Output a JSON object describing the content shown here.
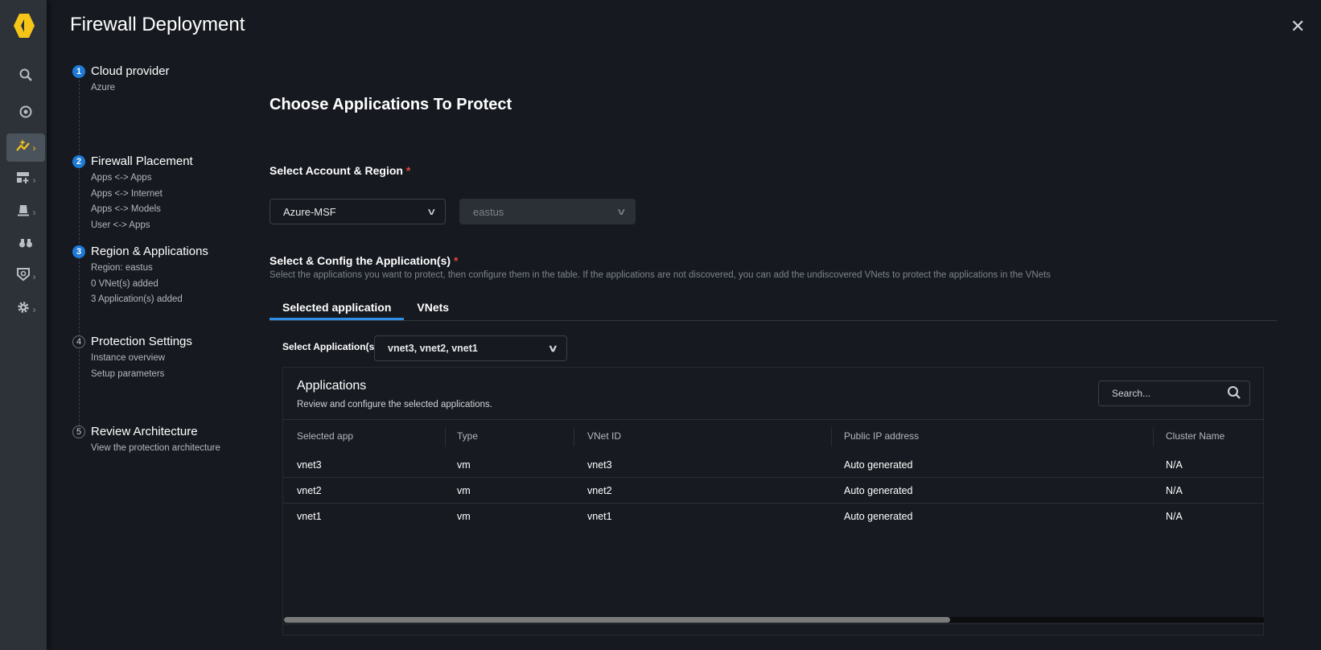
{
  "app": {
    "title": "Firewall Deployment",
    "close": "✕"
  },
  "sidebar": {
    "items": [
      {
        "icon": "search-icon"
      },
      {
        "icon": "radar-icon"
      },
      {
        "icon": "deploy-icon",
        "active": true
      },
      {
        "icon": "dashboard-add-icon"
      },
      {
        "icon": "alarm-icon"
      },
      {
        "icon": "binoculars-icon"
      },
      {
        "icon": "shield-search-icon"
      },
      {
        "icon": "gear-icon"
      }
    ],
    "chevron": "›"
  },
  "steps": [
    {
      "num": "1",
      "title": "Cloud provider",
      "subs": [
        "Azure"
      ]
    },
    {
      "num": "2",
      "title": "Firewall Placement",
      "subs": [
        "Apps <-> Apps",
        "Apps <-> Internet",
        "Apps <-> Models",
        "User <-> Apps"
      ]
    },
    {
      "num": "3",
      "title": "Region & Applications",
      "subs": [
        "Region: eastus",
        "0 VNet(s) added",
        "3 Application(s) added"
      ]
    },
    {
      "num": "4",
      "title": "Protection Settings",
      "subs": [
        "Instance overview",
        "Setup parameters"
      ]
    },
    {
      "num": "5",
      "title": "Review Architecture",
      "subs": [
        "View the protection architecture"
      ]
    }
  ],
  "main": {
    "heading": "Choose Applications To Protect",
    "account_label": "Select Account & Region",
    "required": "*",
    "account": "Azure-MSF",
    "region": "eastus",
    "config_label": "Select & Config the Application(s)",
    "description": "Select the applications you want to protect, then configure them in the table. If the applications are not discovered, you can add the undiscovered VNets to protect the applications in the VNets",
    "tabs": [
      "Selected application",
      "VNets"
    ],
    "select_apps_label": "Select Application(s)",
    "select_apps_value": "vnet3, vnet2, vnet1",
    "arrow": "∨"
  },
  "table": {
    "title": "Applications",
    "subtitle": "Review and configure the selected applications.",
    "search_placeholder": "Search...",
    "columns": [
      "Selected app",
      "Type",
      "VNet ID",
      "Public IP address",
      "Cluster Name"
    ],
    "rows": [
      [
        "vnet3",
        "vm",
        "vnet3",
        "Auto generated",
        "N/A"
      ],
      [
        "vnet2",
        "vm",
        "vnet2",
        "Auto generated",
        "N/A"
      ],
      [
        "vnet1",
        "vm",
        "vnet1",
        "Auto generated",
        "N/A"
      ]
    ],
    "scroll_fraction": 0.68
  }
}
